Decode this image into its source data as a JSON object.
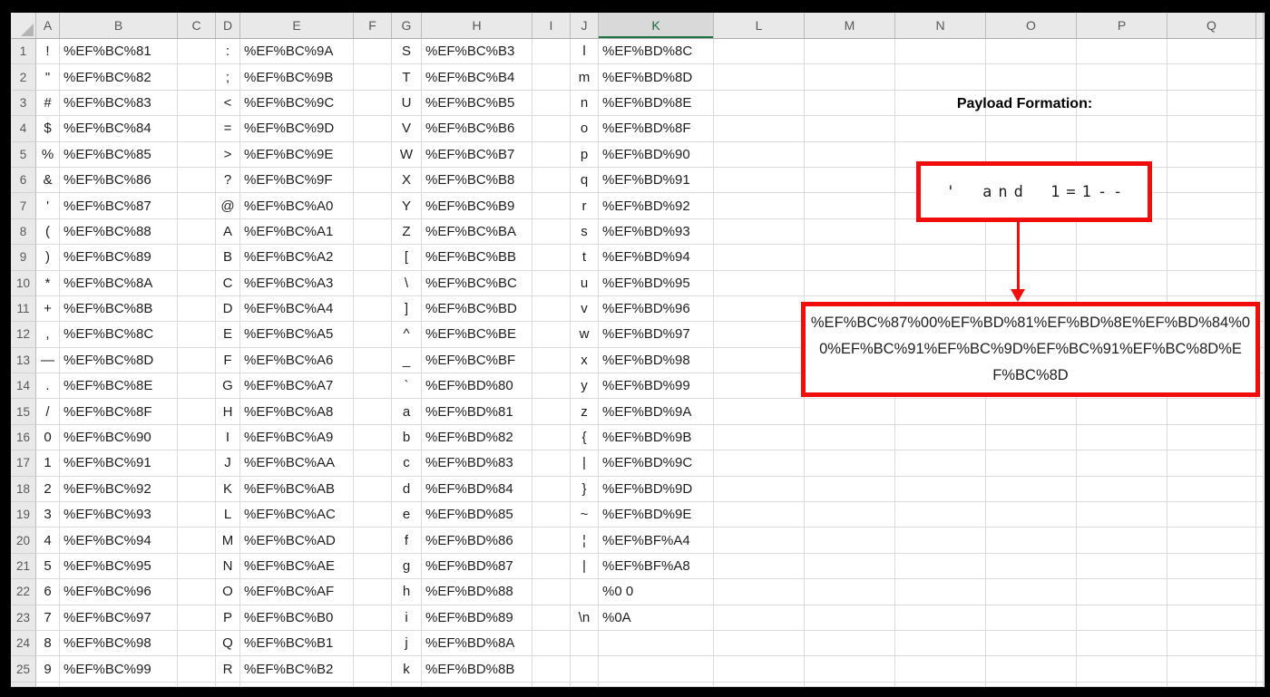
{
  "colors": {
    "accent_red": "#f20d0d",
    "header_green": "#217346",
    "header_green_text": "#1a6a40"
  },
  "grid": {
    "columns": [
      {
        "label": "A"
      },
      {
        "label": "B"
      },
      {
        "label": "C"
      },
      {
        "label": "D"
      },
      {
        "label": "E"
      },
      {
        "label": "F"
      },
      {
        "label": "G"
      },
      {
        "label": "H"
      },
      {
        "label": "I"
      },
      {
        "label": "J"
      },
      {
        "label": "K",
        "selected": true
      },
      {
        "label": "L"
      },
      {
        "label": "M"
      },
      {
        "label": "N"
      },
      {
        "label": "O"
      },
      {
        "label": "P"
      },
      {
        "label": "Q"
      }
    ],
    "rows": [
      {
        "n": "1",
        "A": "!",
        "B": "%EF%BC%81",
        "D": ":",
        "E": "%EF%BC%9A",
        "G": "S",
        "H": "%EF%BC%B3",
        "J": "l",
        "K": "%EF%BD%8C"
      },
      {
        "n": "2",
        "A": "\"",
        "B": "%EF%BC%82",
        "D": ";",
        "E": "%EF%BC%9B",
        "G": "T",
        "H": "%EF%BC%B4",
        "J": "m",
        "K": "%EF%BD%8D"
      },
      {
        "n": "3",
        "A": "#",
        "B": "%EF%BC%83",
        "D": "<",
        "E": "%EF%BC%9C",
        "G": "U",
        "H": "%EF%BC%B5",
        "J": "n",
        "K": "%EF%BD%8E"
      },
      {
        "n": "4",
        "A": "$",
        "B": "%EF%BC%84",
        "D": "=",
        "E": "%EF%BC%9D",
        "G": "V",
        "H": "%EF%BC%B6",
        "J": "o",
        "K": "%EF%BD%8F"
      },
      {
        "n": "5",
        "A": "%",
        "B": "%EF%BC%85",
        "D": ">",
        "E": "%EF%BC%9E",
        "G": "W",
        "H": "%EF%BC%B7",
        "J": "p",
        "K": "%EF%BD%90"
      },
      {
        "n": "6",
        "A": "&",
        "B": "%EF%BC%86",
        "D": "?",
        "E": "%EF%BC%9F",
        "G": "X",
        "H": "%EF%BC%B8",
        "J": "q",
        "K": "%EF%BD%91"
      },
      {
        "n": "7",
        "A": "'",
        "B": "%EF%BC%87",
        "D": "@",
        "E": "%EF%BC%A0",
        "G": "Y",
        "H": "%EF%BC%B9",
        "J": "r",
        "K": "%EF%BD%92"
      },
      {
        "n": "8",
        "A": "(",
        "B": "%EF%BC%88",
        "D": "A",
        "E": "%EF%BC%A1",
        "G": "Z",
        "H": "%EF%BC%BA",
        "J": "s",
        "K": "%EF%BD%93"
      },
      {
        "n": "9",
        "A": ")",
        "B": "%EF%BC%89",
        "D": "B",
        "E": "%EF%BC%A2",
        "G": "[",
        "H": "%EF%BC%BB",
        "J": "t",
        "K": "%EF%BD%94"
      },
      {
        "n": "10",
        "A": "*",
        "B": "%EF%BC%8A",
        "D": "C",
        "E": "%EF%BC%A3",
        "G": "\\",
        "H": "%EF%BC%BC",
        "J": "u",
        "K": "%EF%BD%95"
      },
      {
        "n": "11",
        "A": "+",
        "B": "%EF%BC%8B",
        "D": "D",
        "E": "%EF%BC%A4",
        "G": "]",
        "H": "%EF%BC%BD",
        "J": "v",
        "K": "%EF%BD%96"
      },
      {
        "n": "12",
        "A": ",",
        "B": "%EF%BC%8C",
        "D": "E",
        "E": "%EF%BC%A5",
        "G": "^",
        "H": "%EF%BC%BE",
        "J": "w",
        "K": "%EF%BD%97"
      },
      {
        "n": "13",
        "A": "—",
        "B": "%EF%BC%8D",
        "D": "F",
        "E": "%EF%BC%A6",
        "G": "_",
        "H": "%EF%BC%BF",
        "J": "x",
        "K": "%EF%BD%98"
      },
      {
        "n": "14",
        "A": ".",
        "B": "%EF%BC%8E",
        "D": "G",
        "E": "%EF%BC%A7",
        "G": "`",
        "H": "%EF%BD%80",
        "J": "y",
        "K": "%EF%BD%99"
      },
      {
        "n": "15",
        "A": "/",
        "B": "%EF%BC%8F",
        "D": "H",
        "E": "%EF%BC%A8",
        "G": "a",
        "H": "%EF%BD%81",
        "J": "z",
        "K": "%EF%BD%9A"
      },
      {
        "n": "16",
        "A": "0",
        "B": "%EF%BC%90",
        "D": "I",
        "E": "%EF%BC%A9",
        "G": "b",
        "H": "%EF%BD%82",
        "J": "{",
        "K": "%EF%BD%9B"
      },
      {
        "n": "17",
        "A": "1",
        "B": "%EF%BC%91",
        "D": "J",
        "E": "%EF%BC%AA",
        "G": "c",
        "H": "%EF%BD%83",
        "J": "|",
        "K": "%EF%BD%9C"
      },
      {
        "n": "18",
        "A": "2",
        "B": "%EF%BC%92",
        "D": "K",
        "E": "%EF%BC%AB",
        "G": "d",
        "H": "%EF%BD%84",
        "J": "}",
        "K": "%EF%BD%9D"
      },
      {
        "n": "19",
        "A": "3",
        "B": "%EF%BC%93",
        "D": "L",
        "E": "%EF%BC%AC",
        "G": "e",
        "H": "%EF%BD%85",
        "J": "~",
        "K": "%EF%BD%9E"
      },
      {
        "n": "20",
        "A": "4",
        "B": "%EF%BC%94",
        "D": "M",
        "E": "%EF%BC%AD",
        "G": "f",
        "H": "%EF%BD%86",
        "J": "¦",
        "K": "%EF%BF%A4"
      },
      {
        "n": "21",
        "A": "5",
        "B": "%EF%BC%95",
        "D": "N",
        "E": "%EF%BC%AE",
        "G": "g",
        "H": "%EF%BD%87",
        "J": "|",
        "K": "%EF%BF%A8"
      },
      {
        "n": "22",
        "A": "6",
        "B": "%EF%BC%96",
        "D": "O",
        "E": "%EF%BC%AF",
        "G": "h",
        "H": "%EF%BD%88",
        "J": "",
        "K": "%0 0"
      },
      {
        "n": "23",
        "A": "7",
        "B": "%EF%BC%97",
        "D": "P",
        "E": "%EF%BC%B0",
        "G": "i",
        "H": "%EF%BD%89",
        "J": "\\n",
        "K": "%0A"
      },
      {
        "n": "24",
        "A": "8",
        "B": "%EF%BC%98",
        "D": "Q",
        "E": "%EF%BC%B1",
        "G": "j",
        "H": "%EF%BD%8A",
        "J": "",
        "K": ""
      },
      {
        "n": "25",
        "A": "9",
        "B": "%EF%BC%99",
        "D": "R",
        "E": "%EF%BC%B2",
        "G": "k",
        "H": "%EF%BD%8B",
        "J": "",
        "K": ""
      }
    ]
  },
  "annotation": {
    "title": "Payload Formation:",
    "payload_plain": "' and 1=1--",
    "payload_encoded": "%EF%BC%87%00%EF%BD%81%EF%BD%8E%EF%BD%84%00%EF%BC%91%EF%BC%9D%EF%BC%91%EF%BC%8D%EF%BC%8D"
  }
}
